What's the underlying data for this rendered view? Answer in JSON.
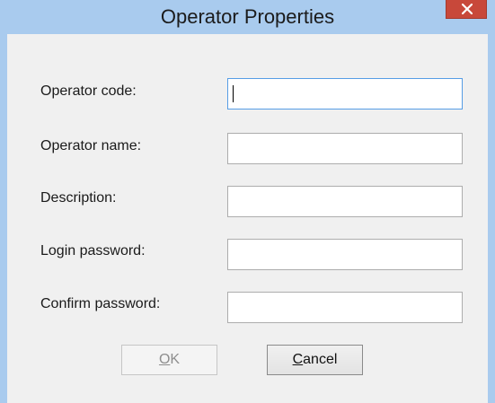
{
  "window": {
    "title": "Operator Properties",
    "close_icon": "close-icon",
    "colors": {
      "frame": "#a9cbee",
      "close_button": "#c8483a",
      "client": "#f0f0f0",
      "focus_border": "#569de5"
    }
  },
  "form": {
    "fields": [
      {
        "label": "Operator code:",
        "value": "",
        "focused": true
      },
      {
        "label": "Operator name:",
        "value": ""
      },
      {
        "label": "Description:",
        "value": ""
      },
      {
        "label": "Login password:",
        "value": ""
      },
      {
        "label": "Confirm password:",
        "value": ""
      }
    ]
  },
  "buttons": {
    "ok": {
      "accel": "O",
      "rest": "K",
      "enabled": false
    },
    "cancel": {
      "accel": "C",
      "rest": "ancel",
      "enabled": true
    }
  }
}
